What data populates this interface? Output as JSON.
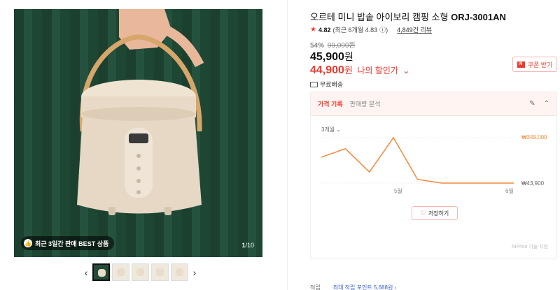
{
  "gallery": {
    "badge_icon": "thumbs-up-icon",
    "badge_text": "최근 3일간 판매 BEST 상품",
    "page_current": "1",
    "page_total": "/10",
    "thumbnail_count": 5,
    "prev_arrow": "‹",
    "next_arrow": "›"
  },
  "product": {
    "title": "오르테 미니 밥솥 아이보리 캠핑 소형",
    "model": "ORJ-3001AN",
    "rating": "4.82",
    "rating_detail": "(최근 6개월 4.83",
    "rating_info": "ⓘ)",
    "review_count": "4,849건 리뷰",
    "discount_pct": "54%",
    "original_price": "99,000원",
    "price": "45,900",
    "price_unit": "원",
    "my_price": "44,900",
    "my_price_unit": "원",
    "my_price_label": "나의 할인가",
    "coupon_label": "쿠폰 받기",
    "shipping": "무료배송"
  },
  "panel": {
    "tabs": [
      {
        "label": "가격 기록",
        "active": true
      },
      {
        "label": "판매량 분석",
        "active": false
      }
    ],
    "period": "3개월",
    "save_label": "저장하기",
    "credit": "AIPrice 기술 지원"
  },
  "chart_data": {
    "type": "line",
    "x_labels": [
      "5월",
      "6월"
    ],
    "values": [
      350,
      420,
      230,
      510,
      170,
      140,
      140,
      140,
      140
    ],
    "max_label": "₩349,000",
    "min_label": "₩43,900",
    "line_color": "#f5883a"
  },
  "bottom": {
    "label": "적립",
    "points": "최대 적립 포인트 5,688원 ›"
  },
  "colors": {
    "accent": "#f03a2f",
    "chart": "#f5883a"
  }
}
